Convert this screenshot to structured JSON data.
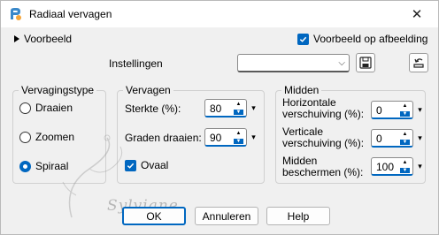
{
  "window": {
    "title": "Radiaal vervagen",
    "close_glyph": "✕"
  },
  "header": {
    "preview_toggle_label": "Voorbeeld",
    "preview_on_image_label": "Voorbeeld op afbeelding",
    "settings_label": "Instellingen",
    "settings_value": ""
  },
  "group_type": {
    "title": "Vervagingstype",
    "options": [
      {
        "label": "Draaien",
        "selected": false
      },
      {
        "label": "Zoomen",
        "selected": false
      },
      {
        "label": "Spiraal",
        "selected": true
      }
    ]
  },
  "group_blur": {
    "title": "Vervagen",
    "strength_label": "Sterkte (%):",
    "strength_value": "80",
    "rotate_label": "Graden draaien:",
    "rotate_value": "90",
    "oval_label": "Ovaal",
    "oval_checked": true
  },
  "group_center": {
    "title": "Midden",
    "h_label_1": "Horizontale",
    "h_label_2": "verschuiving (%):",
    "h_value": "0",
    "v_label_1": "Verticale",
    "v_label_2": "verschuiving (%):",
    "v_value": "0",
    "p_label_1": "Midden",
    "p_label_2": "beschermen (%):",
    "p_value": "100"
  },
  "buttons": {
    "ok": "OK",
    "cancel": "Annuleren",
    "help": "Help"
  },
  "watermark_text": "Sylviane",
  "colors": {
    "accent": "#0067c0",
    "background": "#f0f0f0"
  },
  "icons": [
    "app-icon",
    "close-icon",
    "expand-triangle-icon",
    "save-icon",
    "reset-icon"
  ]
}
